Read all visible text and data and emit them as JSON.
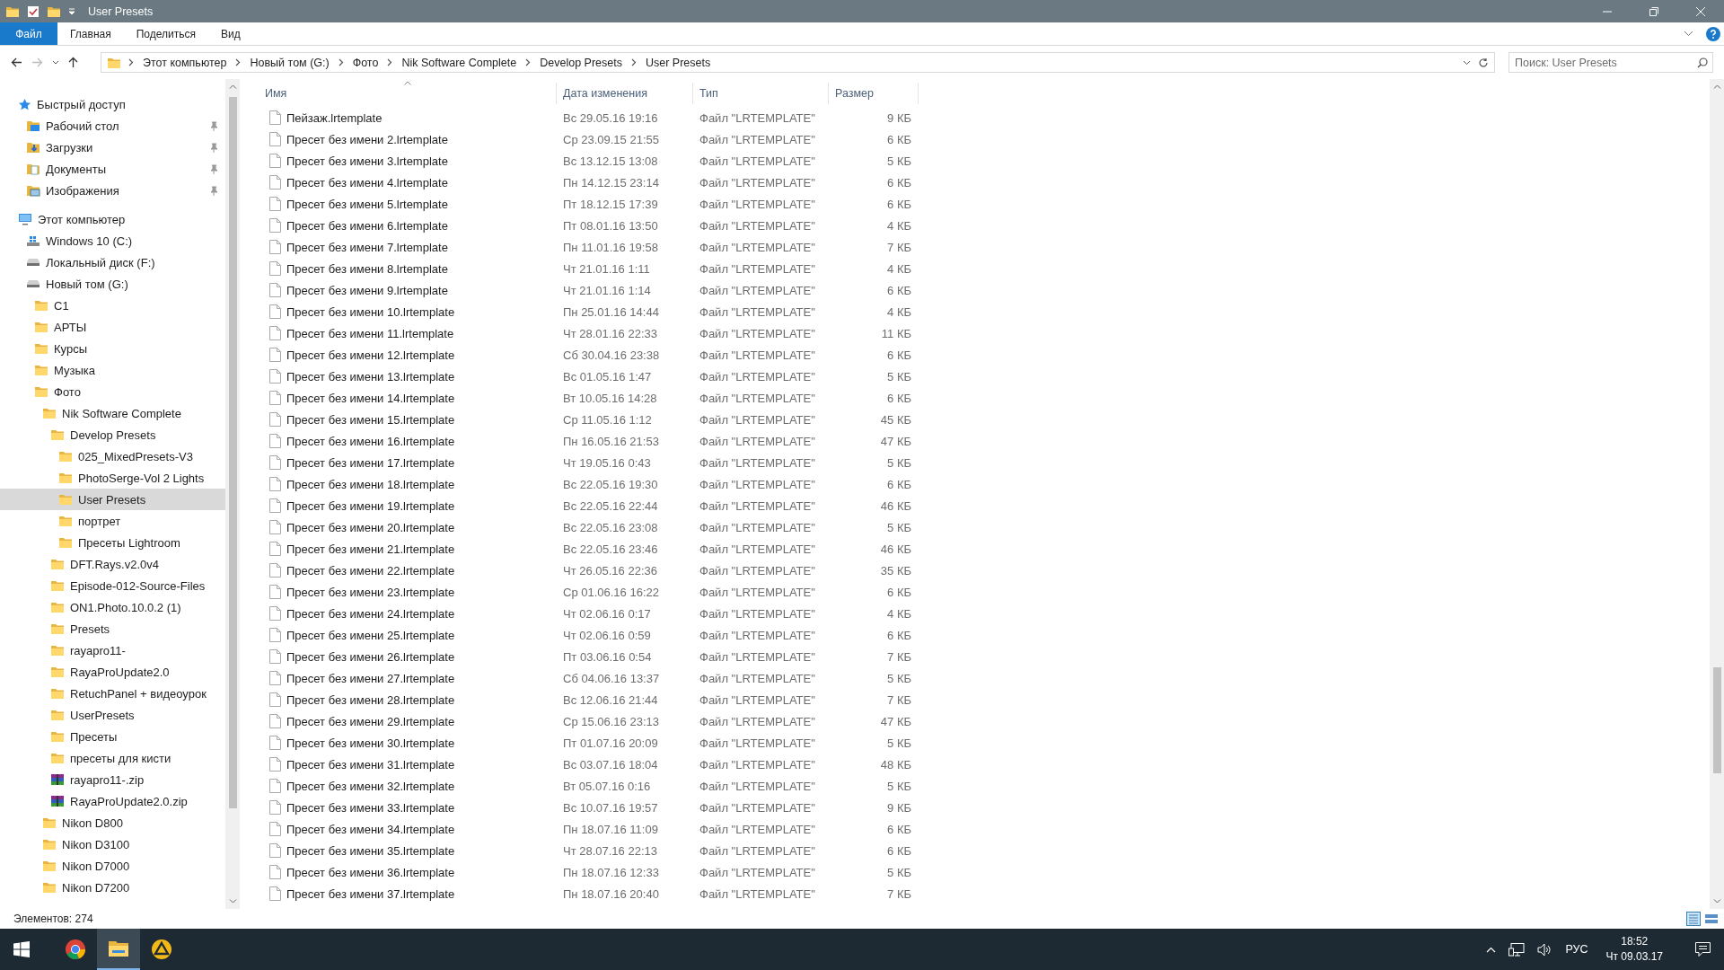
{
  "window": {
    "title": "User Presets"
  },
  "ribbon_tabs": [
    {
      "label": "Файл",
      "kind": "file"
    },
    {
      "label": "Главная",
      "kind": "tab"
    },
    {
      "label": "Поделиться",
      "kind": "tab"
    },
    {
      "label": "Вид",
      "kind": "tab"
    }
  ],
  "address_bar": {
    "breadcrumbs": [
      "Этот компьютер",
      "Новый том (G:)",
      "Фото",
      "Nik Software Complete",
      "Develop Presets",
      "User Presets"
    ]
  },
  "search": {
    "placeholder": "Поиск: User Presets"
  },
  "sidebar": {
    "items": [
      {
        "label": "Быстрый доступ",
        "kind": "quick-access",
        "selected": false,
        "children": [
          {
            "label": "Рабочий стол",
            "kind": "desktop",
            "selected": false,
            "pinned": true
          },
          {
            "label": "Загрузки",
            "kind": "downloads",
            "selected": false,
            "pinned": true
          },
          {
            "label": "Документы",
            "kind": "documents",
            "selected": false,
            "pinned": true
          },
          {
            "label": "Изображения",
            "kind": "pictures",
            "selected": false,
            "pinned": true
          }
        ]
      },
      {
        "label": "Этот компьютер",
        "kind": "computer",
        "selected": false,
        "children": [
          {
            "label": "Windows 10 (C:)",
            "kind": "system-drive",
            "selected": false
          },
          {
            "label": "Локальный диск (F:)",
            "kind": "drive",
            "selected": false
          },
          {
            "label": "Новый том (G:)",
            "kind": "drive",
            "selected": false,
            "children": [
              {
                "label": "C1",
                "kind": "folder",
                "selected": false
              },
              {
                "label": "АРТЫ",
                "kind": "folder",
                "selected": false
              },
              {
                "label": "Курсы",
                "kind": "folder",
                "selected": false
              },
              {
                "label": "Музыка",
                "kind": "folder",
                "selected": false
              },
              {
                "label": "Фото",
                "kind": "folder",
                "selected": false,
                "children": [
                  {
                    "label": "Nik Software Complete",
                    "kind": "folder",
                    "selected": false,
                    "children": [
                      {
                        "label": "Develop Presets",
                        "kind": "folder",
                        "selected": false,
                        "children": [
                          {
                            "label": "025_MixedPresets-V3",
                            "kind": "folder",
                            "selected": false
                          },
                          {
                            "label": "PhotoSerge-Vol 2 Lights",
                            "kind": "folder",
                            "selected": false
                          },
                          {
                            "label": "User Presets",
                            "kind": "folder",
                            "selected": true
                          },
                          {
                            "label": "портрет",
                            "kind": "folder",
                            "selected": false
                          },
                          {
                            "label": "Пресеты Lightroom",
                            "kind": "folder",
                            "selected": false
                          }
                        ]
                      },
                      {
                        "label": "DFT.Rays.v2.0v4",
                        "kind": "folder",
                        "selected": false
                      },
                      {
                        "label": "Episode-012-Source-Files",
                        "kind": "folder",
                        "selected": false
                      },
                      {
                        "label": "ON1.Photo.10.0.2 (1)",
                        "kind": "folder",
                        "selected": false
                      },
                      {
                        "label": "Presets",
                        "kind": "folder",
                        "selected": false
                      },
                      {
                        "label": "rayapro11-",
                        "kind": "folder",
                        "selected": false
                      },
                      {
                        "label": "RayaProUpdate2.0",
                        "kind": "folder",
                        "selected": false
                      },
                      {
                        "label": "RetuchPanel + видеоурок",
                        "kind": "folder",
                        "selected": false
                      },
                      {
                        "label": "UserPresets",
                        "kind": "folder",
                        "selected": false
                      },
                      {
                        "label": "Пресеты",
                        "kind": "folder",
                        "selected": false
                      },
                      {
                        "label": "пресеты для кисти",
                        "kind": "folder",
                        "selected": false
                      },
                      {
                        "label": "rayapro11-.zip",
                        "kind": "archive",
                        "selected": false
                      },
                      {
                        "label": "RayaProUpdate2.0.zip",
                        "kind": "archive",
                        "selected": false
                      }
                    ]
                  },
                  {
                    "label": "Nikon D800",
                    "kind": "folder",
                    "selected": false
                  },
                  {
                    "label": "Nikon D3100",
                    "kind": "folder",
                    "selected": false
                  },
                  {
                    "label": "Nikon D7000",
                    "kind": "folder",
                    "selected": false
                  },
                  {
                    "label": "Nikon D7200",
                    "kind": "folder",
                    "selected": false
                  }
                ]
              }
            ]
          }
        ]
      }
    ]
  },
  "table": {
    "columns": [
      "Имя",
      "Дата изменения",
      "Тип",
      "Размер"
    ],
    "rows": [
      {
        "name": "Пейзаж.lrtemplate",
        "modified": "Вс 29.05.16 19:16",
        "type": "Файл \"LRTEMPLATE\"",
        "size": "9 КБ"
      },
      {
        "name": "Пресет без имени 2.lrtemplate",
        "modified": "Ср 23.09.15 21:55",
        "type": "Файл \"LRTEMPLATE\"",
        "size": "6 КБ"
      },
      {
        "name": "Пресет без имени 3.lrtemplate",
        "modified": "Вс 13.12.15 13:08",
        "type": "Файл \"LRTEMPLATE\"",
        "size": "5 КБ"
      },
      {
        "name": "Пресет без имени 4.lrtemplate",
        "modified": "Пн 14.12.15 23:14",
        "type": "Файл \"LRTEMPLATE\"",
        "size": "6 КБ"
      },
      {
        "name": "Пресет без имени 5.lrtemplate",
        "modified": "Пт 18.12.15 17:39",
        "type": "Файл \"LRTEMPLATE\"",
        "size": "6 КБ"
      },
      {
        "name": "Пресет без имени 6.lrtemplate",
        "modified": "Пт 08.01.16 13:50",
        "type": "Файл \"LRTEMPLATE\"",
        "size": "4 КБ"
      },
      {
        "name": "Пресет без имени 7.lrtemplate",
        "modified": "Пн 11.01.16 19:58",
        "type": "Файл \"LRTEMPLATE\"",
        "size": "7 КБ"
      },
      {
        "name": "Пресет без имени 8.lrtemplate",
        "modified": "Чт 21.01.16 1:11",
        "type": "Файл \"LRTEMPLATE\"",
        "size": "4 КБ"
      },
      {
        "name": "Пресет без имени 9.lrtemplate",
        "modified": "Чт 21.01.16 1:14",
        "type": "Файл \"LRTEMPLATE\"",
        "size": "6 КБ"
      },
      {
        "name": "Пресет без имени 10.lrtemplate",
        "modified": "Пн 25.01.16 14:44",
        "type": "Файл \"LRTEMPLATE\"",
        "size": "4 КБ"
      },
      {
        "name": "Пресет без имени 11.lrtemplate",
        "modified": "Чт 28.01.16 22:33",
        "type": "Файл \"LRTEMPLATE\"",
        "size": "11 КБ"
      },
      {
        "name": "Пресет без имени 12.lrtemplate",
        "modified": "Сб 30.04.16 23:38",
        "type": "Файл \"LRTEMPLATE\"",
        "size": "6 КБ"
      },
      {
        "name": "Пресет без имени 13.lrtemplate",
        "modified": "Вс 01.05.16 1:47",
        "type": "Файл \"LRTEMPLATE\"",
        "size": "5 КБ"
      },
      {
        "name": "Пресет без имени 14.lrtemplate",
        "modified": "Вт 10.05.16 14:28",
        "type": "Файл \"LRTEMPLATE\"",
        "size": "6 КБ"
      },
      {
        "name": "Пресет без имени 15.lrtemplate",
        "modified": "Ср 11.05.16 1:12",
        "type": "Файл \"LRTEMPLATE\"",
        "size": "45 КБ"
      },
      {
        "name": "Пресет без имени 16.lrtemplate",
        "modified": "Пн 16.05.16 21:53",
        "type": "Файл \"LRTEMPLATE\"",
        "size": "47 КБ"
      },
      {
        "name": "Пресет без имени 17.lrtemplate",
        "modified": "Чт 19.05.16 0:43",
        "type": "Файл \"LRTEMPLATE\"",
        "size": "5 КБ"
      },
      {
        "name": "Пресет без имени 18.lrtemplate",
        "modified": "Вс 22.05.16 19:30",
        "type": "Файл \"LRTEMPLATE\"",
        "size": "6 КБ"
      },
      {
        "name": "Пресет без имени 19.lrtemplate",
        "modified": "Вс 22.05.16 22:44",
        "type": "Файл \"LRTEMPLATE\"",
        "size": "46 КБ"
      },
      {
        "name": "Пресет без имени 20.lrtemplate",
        "modified": "Вс 22.05.16 23:08",
        "type": "Файл \"LRTEMPLATE\"",
        "size": "5 КБ"
      },
      {
        "name": "Пресет без имени 21.lrtemplate",
        "modified": "Вс 22.05.16 23:46",
        "type": "Файл \"LRTEMPLATE\"",
        "size": "46 КБ"
      },
      {
        "name": "Пресет без имени 22.lrtemplate",
        "modified": "Чт 26.05.16 22:36",
        "type": "Файл \"LRTEMPLATE\"",
        "size": "35 КБ"
      },
      {
        "name": "Пресет без имени 23.lrtemplate",
        "modified": "Ср 01.06.16 16:22",
        "type": "Файл \"LRTEMPLATE\"",
        "size": "6 КБ"
      },
      {
        "name": "Пресет без имени 24.lrtemplate",
        "modified": "Чт 02.06.16 0:17",
        "type": "Файл \"LRTEMPLATE\"",
        "size": "4 КБ"
      },
      {
        "name": "Пресет без имени 25.lrtemplate",
        "modified": "Чт 02.06.16 0:59",
        "type": "Файл \"LRTEMPLATE\"",
        "size": "6 КБ"
      },
      {
        "name": "Пресет без имени 26.lrtemplate",
        "modified": "Пт 03.06.16 0:54",
        "type": "Файл \"LRTEMPLATE\"",
        "size": "7 КБ"
      },
      {
        "name": "Пресет без имени 27.lrtemplate",
        "modified": "Сб 04.06.16 13:37",
        "type": "Файл \"LRTEMPLATE\"",
        "size": "5 КБ"
      },
      {
        "name": "Пресет без имени 28.lrtemplate",
        "modified": "Вс 12.06.16 21:44",
        "type": "Файл \"LRTEMPLATE\"",
        "size": "7 КБ"
      },
      {
        "name": "Пресет без имени 29.lrtemplate",
        "modified": "Ср 15.06.16 23:13",
        "type": "Файл \"LRTEMPLATE\"",
        "size": "47 КБ"
      },
      {
        "name": "Пресет без имени 30.lrtemplate",
        "modified": "Пт 01.07.16 20:09",
        "type": "Файл \"LRTEMPLATE\"",
        "size": "5 КБ"
      },
      {
        "name": "Пресет без имени 31.lrtemplate",
        "modified": "Вс 03.07.16 18:04",
        "type": "Файл \"LRTEMPLATE\"",
        "size": "48 КБ"
      },
      {
        "name": "Пресет без имени 32.lrtemplate",
        "modified": "Вт 05.07.16 0:16",
        "type": "Файл \"LRTEMPLATE\"",
        "size": "5 КБ"
      },
      {
        "name": "Пресет без имени 33.lrtemplate",
        "modified": "Вс 10.07.16 19:57",
        "type": "Файл \"LRTEMPLATE\"",
        "size": "9 КБ"
      },
      {
        "name": "Пресет без имени 34.lrtemplate",
        "modified": "Пн 18.07.16 11:09",
        "type": "Файл \"LRTEMPLATE\"",
        "size": "6 КБ"
      },
      {
        "name": "Пресет без имени 35.lrtemplate",
        "modified": "Чт 28.07.16 22:13",
        "type": "Файл \"LRTEMPLATE\"",
        "size": "6 КБ"
      },
      {
        "name": "Пресет без имени 36.lrtemplate",
        "modified": "Пн 18.07.16 12:33",
        "type": "Файл \"LRTEMPLATE\"",
        "size": "5 КБ"
      },
      {
        "name": "Пресет без имени 37.lrtemplate",
        "modified": "Пн 18.07.16 20:40",
        "type": "Файл \"LRTEMPLATE\"",
        "size": "7 КБ"
      }
    ]
  },
  "status_bar": {
    "item_count": "Элементов: 274"
  },
  "taskbar": {
    "language": "РУС",
    "time": "18:52",
    "date": "Чт 09.03.17"
  }
}
